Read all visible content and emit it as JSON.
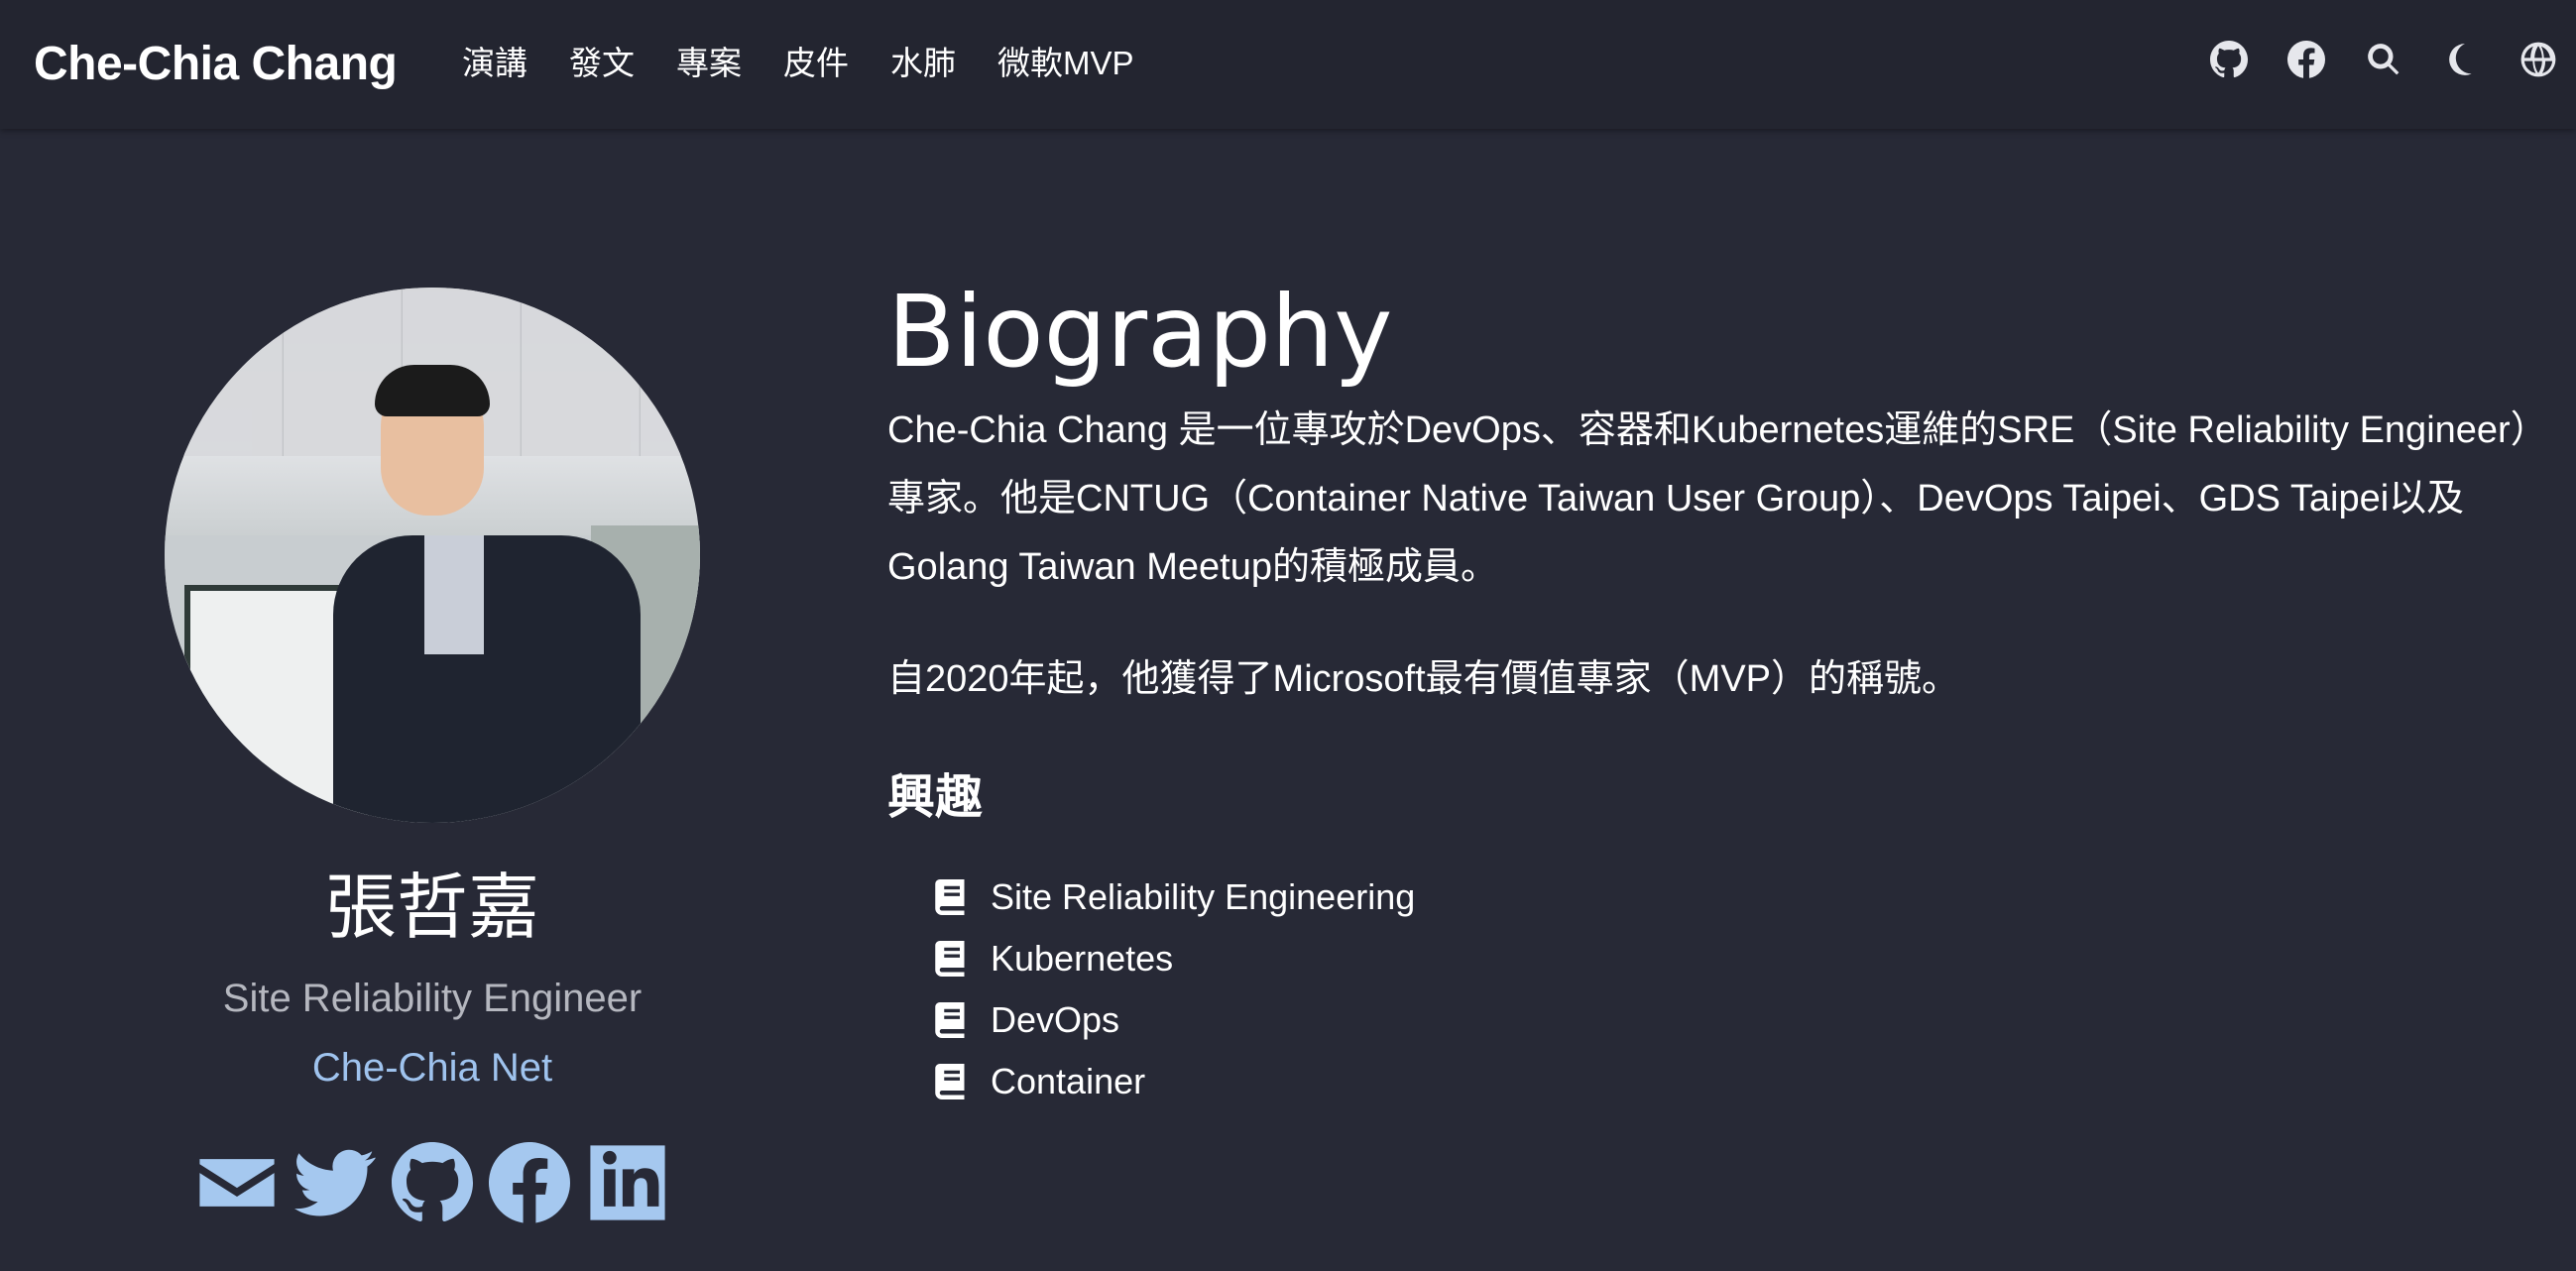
{
  "brand": "Che-Chia Chang",
  "nav": {
    "links": [
      "演講",
      "發文",
      "專案",
      "皮件",
      "水肺",
      "微軟MVP"
    ],
    "icons": [
      "github-icon",
      "facebook-icon",
      "search-icon",
      "moon-icon",
      "globe-icon"
    ]
  },
  "profile": {
    "name": "張哲嘉",
    "role": "Site Reliability Engineer",
    "organization": "Che-Chia Net",
    "socials": [
      "envelope-icon",
      "twitter-icon",
      "github-icon",
      "facebook-icon",
      "linkedin-icon"
    ]
  },
  "biography": {
    "title": "Biography",
    "paragraph1": "Che-Chia Chang 是一位專攻於DevOps、容器和Kubernetes運維的SRE（Site Reliability Engineer）專家。他是CNTUG（Container Native Taiwan User Group）、DevOps Taipei、GDS Taipei以及Golang Taiwan Meetup的積極成員。",
    "paragraph2": "自2020年起，他獲得了Microsoft最有價值專家（MVP）的稱號。",
    "interests_title": "興趣",
    "interests": [
      "Site Reliability Engineering",
      "Kubernetes",
      "DevOps",
      "Container"
    ]
  },
  "colors": {
    "background": "#272936",
    "navbar": "#232530",
    "accent": "#9fc3ee",
    "muted_text": "#b5b7bf"
  }
}
